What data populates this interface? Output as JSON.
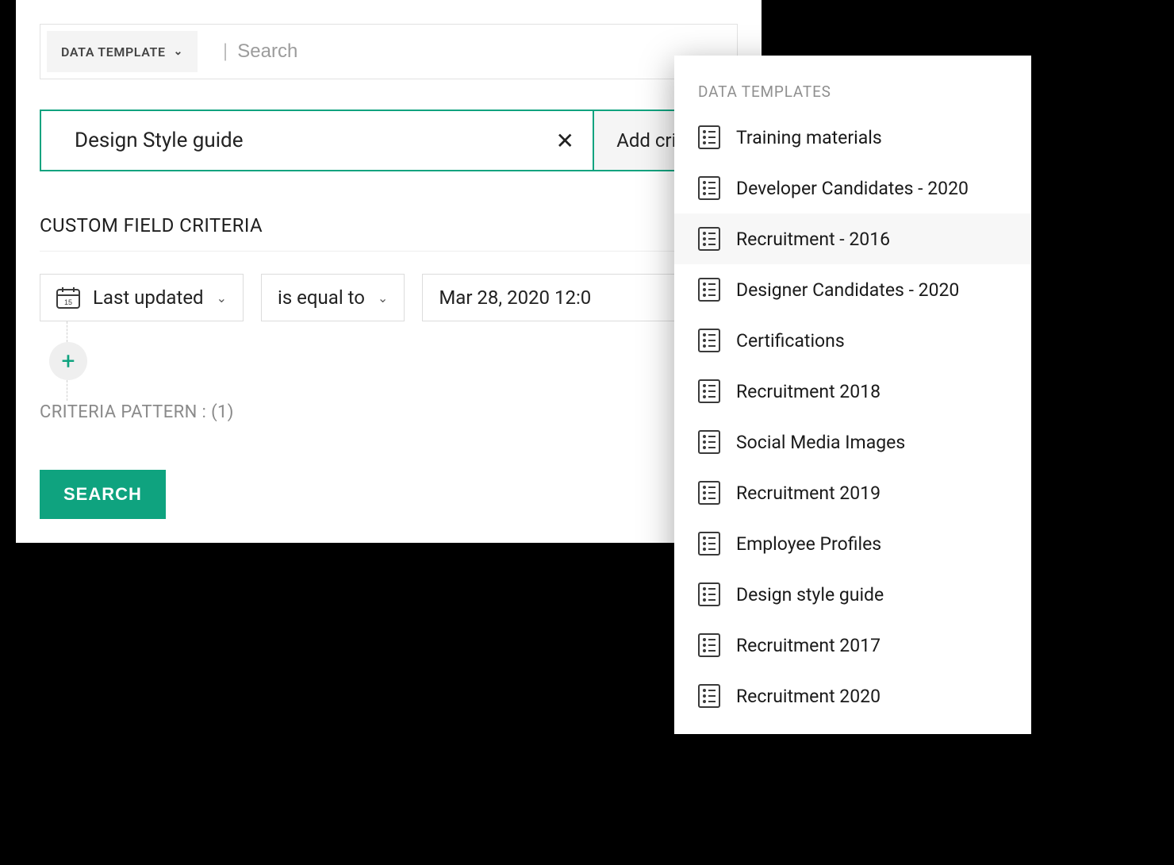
{
  "top": {
    "data_template_label": "DATA TEMPLATE",
    "search_placeholder": "Search"
  },
  "selected": {
    "value": "Design Style guide",
    "add_criteria_label": "Add criteria"
  },
  "section_heading": "CUSTOM FIELD CRITERIA",
  "criteria": {
    "field": "Last updated",
    "operator": "is equal to",
    "value": "Mar 28, 2020 12:0"
  },
  "pattern": {
    "label": "CRITERIA PATTERN :",
    "value": "(1)"
  },
  "search_button": "SEARCH",
  "dropdown": {
    "heading": "DATA TEMPLATES",
    "selected_index": 2,
    "items": [
      "Training materials",
      "Developer Candidates - 2020",
      "Recruitment - 2016",
      "Designer Candidates - 2020",
      "Certifications",
      "Recruitment 2018",
      "Social Media Images",
      "Recruitment 2019",
      "Employee Profiles",
      "Design style guide",
      "Recruitment 2017",
      "Recruitment 2020"
    ]
  },
  "colors": {
    "accent": "#0fa37f"
  }
}
